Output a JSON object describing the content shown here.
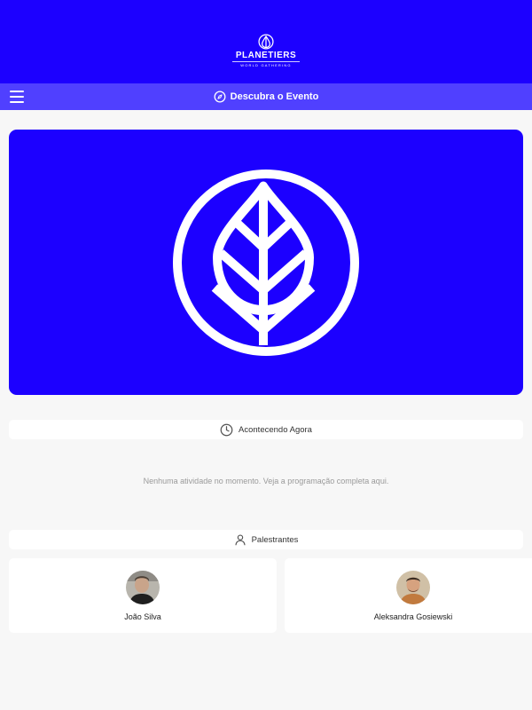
{
  "header": {
    "logo_title": "PLANETIERS",
    "logo_subtitle": "WORLD GATHERING",
    "brand_color": "#1c00ff"
  },
  "nav": {
    "menu_icon": "hamburger-menu-icon",
    "title_icon": "compass-icon",
    "title": "Descubra o Evento",
    "color": "#5040ff"
  },
  "hero": {
    "icon": "leaf-in-circle-logo"
  },
  "now_section": {
    "icon": "clock-icon",
    "title": "Acontecendo Agora",
    "empty_message": "Nenhuma atividade no momento. Veja a programação completa aqui."
  },
  "speakers_section": {
    "icon": "user-icon",
    "title": "Palestrantes",
    "speakers": [
      {
        "name": "João Silva"
      },
      {
        "name": "Aleksandra Gosiewski"
      }
    ]
  }
}
